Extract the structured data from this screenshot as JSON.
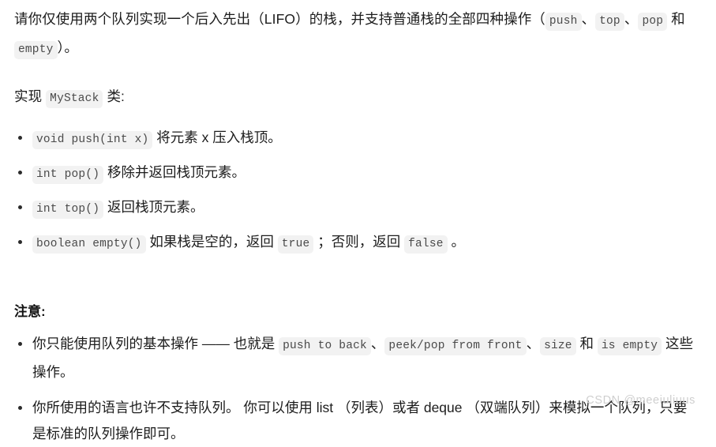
{
  "document": {
    "background_color": "#ffffff",
    "text_color": "#1c1c1c",
    "chip_background_color": "#f2f2f2",
    "chip_text_color": "#4a4a4a",
    "watermark_color": "#cfcfcf"
  },
  "intro": {
    "part1": "请你仅使用两个队列实现一个后入先出（LIFO）的栈，并支持普通栈的全部四种操作（",
    "code1": "push",
    "sep1": "、",
    "code2": "top",
    "sep2": "、",
    "code3": "pop",
    "part2": " 和 ",
    "code4": "empty",
    "part3": "）。"
  },
  "implement": {
    "prefix": "实现 ",
    "class_name": "MyStack",
    "suffix": " 类:"
  },
  "methods": [
    {
      "code": "void push(int x)",
      "text": " 将元素 x 压入栈顶。"
    },
    {
      "code": "int pop()",
      "text": " 移除并返回栈顶元素。"
    },
    {
      "code": "int top()",
      "text": " 返回栈顶元素。"
    },
    {
      "code": "boolean empty()",
      "text_before": " 如果栈是空的，返回 ",
      "code_true": "true",
      "text_middle": " ；否则，返回 ",
      "code_false": "false",
      "text_after": " 。"
    }
  ],
  "notice": {
    "title": "注意:",
    "items": [
      {
        "part1": "你只能使用队列的基本操作 —— 也就是 ",
        "code1": "push to back",
        "sep1": "、",
        "code2": "peek/pop from front",
        "sep2": "、",
        "code3": "size",
        "part2": " 和 ",
        "code4": "is empty",
        "part3": " 这些操作。"
      },
      {
        "text": "你所使用的语言也许不支持队列。 你可以使用 list （列表）或者 deque （双端队列）来模拟一个队列，只要是标准的队列操作即可。"
      }
    ]
  },
  "watermark": {
    "text": "CSDN @meeiuliuus"
  }
}
